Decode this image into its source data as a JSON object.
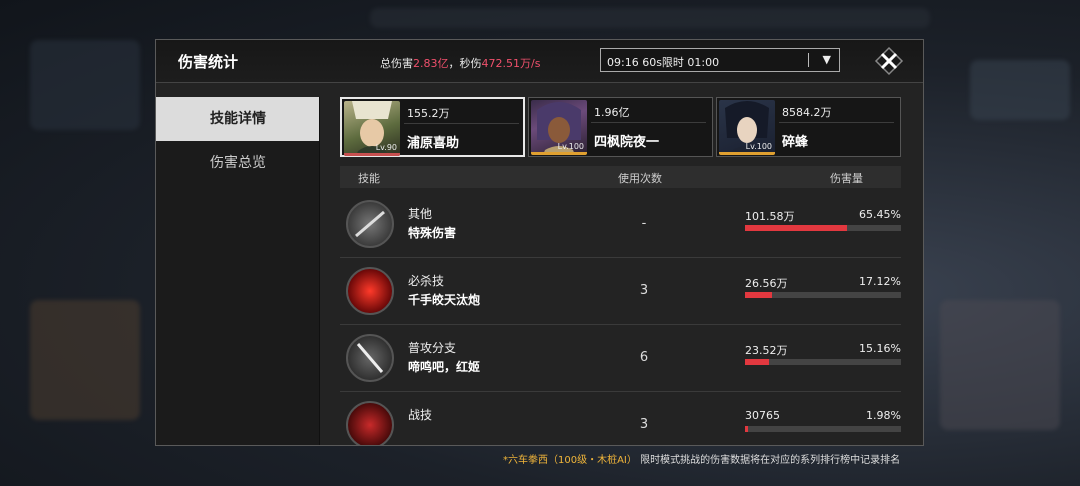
{
  "header": {
    "title": "伤害统计",
    "total_label": "总伤害",
    "total_value": "2.83亿",
    "dps_label": "，秒伤",
    "dps_value": "472.51万/s",
    "mode_select": "09:16 60s限时 01:00"
  },
  "sidebar": {
    "tabs": [
      {
        "label": "技能详情",
        "active": true
      },
      {
        "label": "伤害总览",
        "active": false
      }
    ]
  },
  "characters": [
    {
      "damage": "155.2万",
      "name": "浦原喜助",
      "level": "Lv.90",
      "selected": true
    },
    {
      "damage": "1.96亿",
      "name": "四枫院夜一",
      "level": "Lv.100",
      "selected": false
    },
    {
      "damage": "8584.2万",
      "name": "碎蜂",
      "level": "Lv.100",
      "selected": false
    }
  ],
  "table": {
    "columns": {
      "skill": "技能",
      "uses": "使用次数",
      "damage": "伤害量"
    },
    "rows": [
      {
        "type": "其他",
        "name": "特殊伤害",
        "uses": "-",
        "damage": "101.58万",
        "percent": "65.45%",
        "fraction": 0.6545
      },
      {
        "type": "必杀技",
        "name": "千手皎天汰炮",
        "uses": "3",
        "damage": "26.56万",
        "percent": "17.12%",
        "fraction": 0.1712
      },
      {
        "type": "普攻分支",
        "name": "啼鸣吧，红姬",
        "uses": "6",
        "damage": "23.52万",
        "percent": "15.16%",
        "fraction": 0.1516
      },
      {
        "type": "战技",
        "name": "",
        "uses": "3",
        "damage": "30765",
        "percent": "1.98%",
        "fraction": 0.0198
      }
    ]
  },
  "footer": {
    "highlight": "*六车拳西（100级・木桩AI）",
    "text": "限时模式挑战的伤害数据将在对应的系列排行榜中记录排名"
  },
  "colors": {
    "accent": "#e2383f",
    "highlight": "#f0506c",
    "footer_highlight": "#f0b53a"
  }
}
